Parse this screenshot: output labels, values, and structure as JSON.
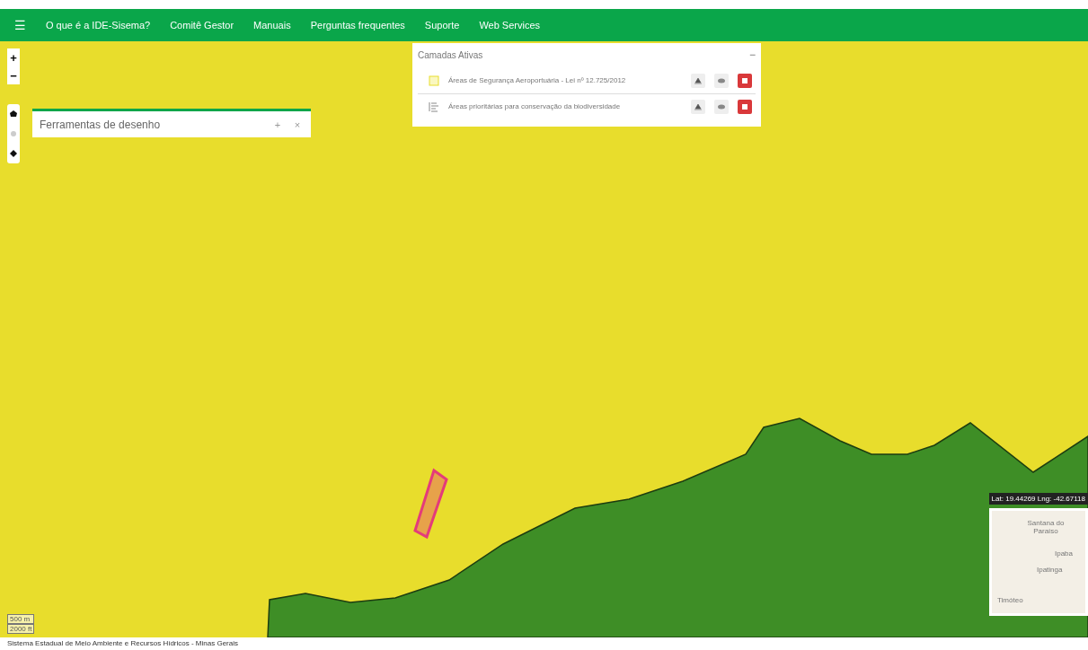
{
  "navbar": {
    "menu_icon": "☰",
    "items": [
      "O que é a IDE-Sisema?",
      "Comitê Gestor",
      "Manuais",
      "Perguntas frequentes",
      "Suporte",
      "Web Services"
    ]
  },
  "zoom_controls": [
    "+",
    "−"
  ],
  "drawing_tools": {
    "title": "Ferramentas de desenho",
    "buttons": [
      "+",
      "×"
    ]
  },
  "active_layers": {
    "title": "Camadas Ativas",
    "collapse": "−",
    "layers": [
      {
        "kind": "polygon",
        "name": "Áreas de Segurança Aeroportuária - Lei nº 12.725/2012"
      },
      {
        "kind": "legend",
        "name": "Áreas prioritárias para conservação da biodiversidade"
      }
    ]
  },
  "coordinates": "Lat: 19.44269 Lng: -42.67118",
  "minimap": {
    "labels": [
      "Santana do Paraíso",
      "Ipaba",
      "Ipatinga",
      "Timóteo"
    ]
  },
  "scale": [
    "500 m",
    "2000 ft"
  ],
  "footer": "Sistema Estadual de Meio Ambiente e Recursos Hídricos - Minas Gerais"
}
